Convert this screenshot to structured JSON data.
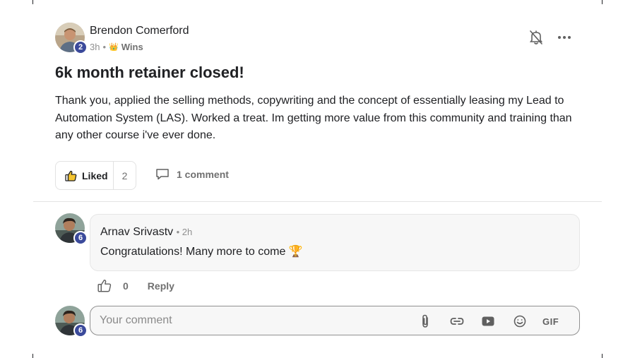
{
  "post": {
    "author": "Brendon Comerford",
    "level": "2",
    "time": "3h",
    "separator": "•",
    "category_emoji": "👑",
    "category": "Wins",
    "title": "6k month retainer closed!",
    "body": "Thank you, applied the selling methods, copywriting and the concept of essentially leasing my Lead to Automation System (LAS). Worked a treat. Im getting more value from this community and training than any other course i've ever done.",
    "like_label": "Liked",
    "like_count": "2",
    "comments_label": "1 comment"
  },
  "comment": {
    "author": "Arnav Srivastv",
    "level": "6",
    "time": "• 2h",
    "text": "Congratulations! Many more to come 🏆",
    "like_count": "0",
    "reply_label": "Reply"
  },
  "composer": {
    "level": "6",
    "placeholder": "Your comment",
    "gif_label": "GIF"
  },
  "icons": {
    "bell": "bell-off-icon",
    "more": "more-horizontal-icon",
    "like": "thumbs-up-icon",
    "comment": "comment-icon",
    "attach": "paperclip-icon",
    "link": "link-icon",
    "video": "youtube-icon",
    "emoji": "emoji-icon"
  },
  "colors": {
    "badge": "#3b4a9b",
    "muted": "#707070",
    "text": "#202124"
  }
}
